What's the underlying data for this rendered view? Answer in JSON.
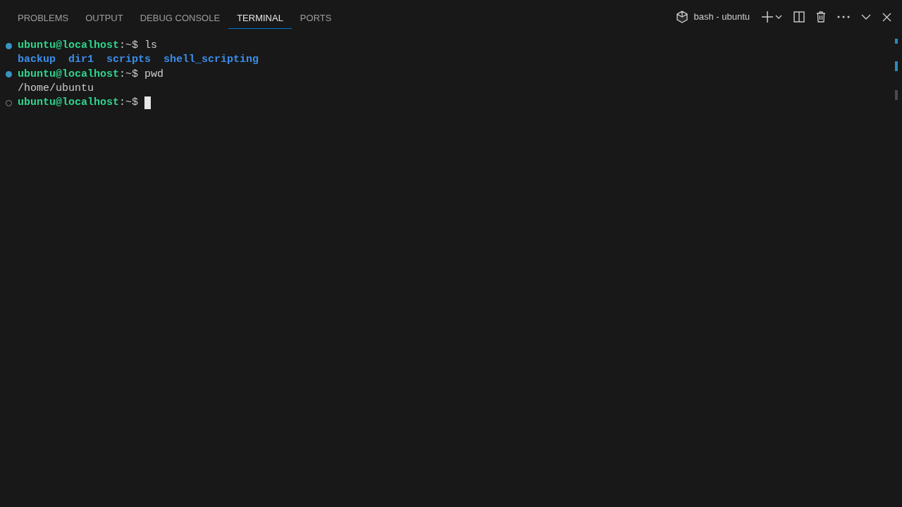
{
  "panel_tabs": [
    {
      "label": "PROBLEMS",
      "selected": false
    },
    {
      "label": "OUTPUT",
      "selected": false
    },
    {
      "label": "DEBUG CONSOLE",
      "selected": false
    },
    {
      "label": "TERMINAL",
      "selected": true
    },
    {
      "label": "PORTS",
      "selected": false
    }
  ],
  "terminal_title": "bash - ubuntu",
  "lines": [
    {
      "kind": "prompt",
      "user_host": "ubuntu@localhost",
      "suffix": ":~$",
      "command": "ls",
      "completed": true,
      "cursor": false
    },
    {
      "kind": "listing",
      "items": [
        "backup",
        "dir1",
        "scripts",
        "shell_scripting"
      ]
    },
    {
      "kind": "prompt",
      "user_host": "ubuntu@localhost",
      "suffix": ":~$",
      "command": "pwd",
      "completed": true,
      "cursor": false
    },
    {
      "kind": "text",
      "text": "/home/ubuntu"
    },
    {
      "kind": "prompt",
      "user_host": "ubuntu@localhost",
      "suffix": ":~$",
      "completed": false,
      "cursor": true
    }
  ]
}
